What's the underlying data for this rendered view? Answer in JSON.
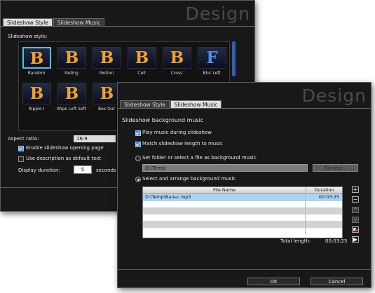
{
  "back": {
    "brand": "Design",
    "tabs": [
      "Slideshow Style",
      "Slideshow Music"
    ],
    "style_label": "Slideshow style:",
    "styles": [
      {
        "glyph": "B",
        "caption": "Random"
      },
      {
        "glyph": "B",
        "caption": "Fading"
      },
      {
        "glyph": "B",
        "caption": "Motion"
      },
      {
        "glyph": "B",
        "caption": "Cell"
      },
      {
        "glyph": "B",
        "caption": "Cross"
      },
      {
        "glyph": "F",
        "caption": "Blur Left"
      },
      {
        "glyph": "B",
        "caption": "Ripple I"
      },
      {
        "glyph": "B",
        "caption": "Wipe Left Soft"
      },
      {
        "glyph": "B",
        "caption": "Box Out"
      }
    ],
    "aspect_label": "Aspect ratio:",
    "aspect_value": "16:9",
    "opening_label": "Enable slideshow opening page",
    "description_label": "Use description as default text",
    "duration_label": "Display duration:",
    "duration_value": "5",
    "duration_unit": "seconds"
  },
  "front": {
    "brand": "Design",
    "tabs": [
      "Slideshow Style",
      "Slideshow Music"
    ],
    "heading": "Slideshow background music",
    "play_label": "Play music during slideshow",
    "match_label": "Match slideshow length to music",
    "folder_label": "Set folder or select a file as background music",
    "folder_path": "D:\\Temp",
    "browse_label": "Browse...",
    "arrange_label": "Select and arrange background music",
    "col_file": "File Name",
    "col_duration": "Duration",
    "rows": [
      {
        "file": "D:\\Temp\\Вальс.mp3",
        "duration": "00:03:25"
      },
      {
        "file": "",
        "duration": ""
      },
      {
        "file": "",
        "duration": ""
      },
      {
        "file": "",
        "duration": ""
      },
      {
        "file": "",
        "duration": ""
      },
      {
        "file": "",
        "duration": ""
      }
    ],
    "total_label": "Total length:",
    "total_value": "00:03:25",
    "side_buttons": [
      "+",
      "−",
      "^",
      "v",
      "",
      "▶"
    ],
    "ok_label": "OK",
    "cancel_label": "Cancel"
  },
  "colors": {
    "window_bg": "#181818",
    "selection": "#46c3f0",
    "row_selected": "#a8d6f4",
    "check_on": "#4d8fd6"
  }
}
